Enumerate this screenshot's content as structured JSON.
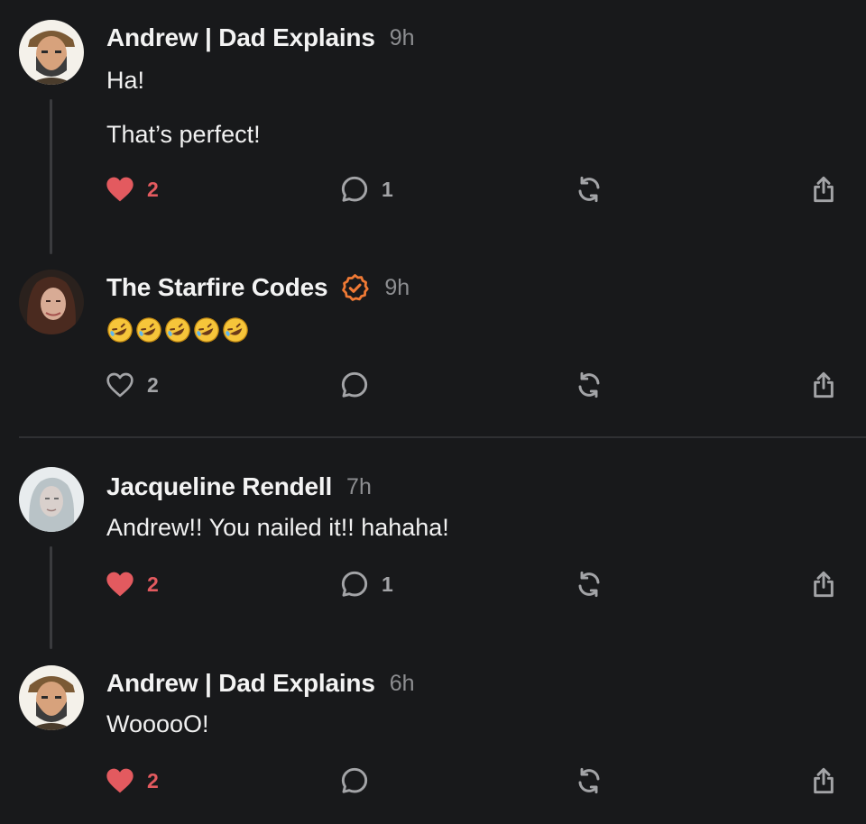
{
  "posts": [
    {
      "author": "Andrew | Dad Explains",
      "time": "9h",
      "lines": [
        "Ha!",
        "That’s perfect!"
      ],
      "likes": "2",
      "liked": true,
      "replies": "1"
    },
    {
      "author": "The Starfire Codes",
      "verified": true,
      "time": "9h",
      "emoji": [
        "rolling-on-floor-laughing",
        "rolling-on-floor-laughing",
        "rolling-on-floor-laughing",
        "rolling-on-floor-laughing",
        "rolling-on-floor-laughing"
      ],
      "likes": "2",
      "liked": false,
      "replies": ""
    },
    {
      "author": "Jacqueline Rendell",
      "time": "7h",
      "lines": [
        "Andrew!! You nailed it!! hahaha!"
      ],
      "likes": "2",
      "liked": true,
      "replies": "1"
    },
    {
      "author": "Andrew | Dad Explains",
      "time": "6h",
      "lines": [
        "WooooO!"
      ],
      "likes": "2",
      "liked": true,
      "replies": ""
    }
  ],
  "colors": {
    "background": "#18191b",
    "liked": "#e35a5f",
    "icon": "#a3a4a7",
    "verified": "#f07a35",
    "divider": "#2f3033"
  }
}
